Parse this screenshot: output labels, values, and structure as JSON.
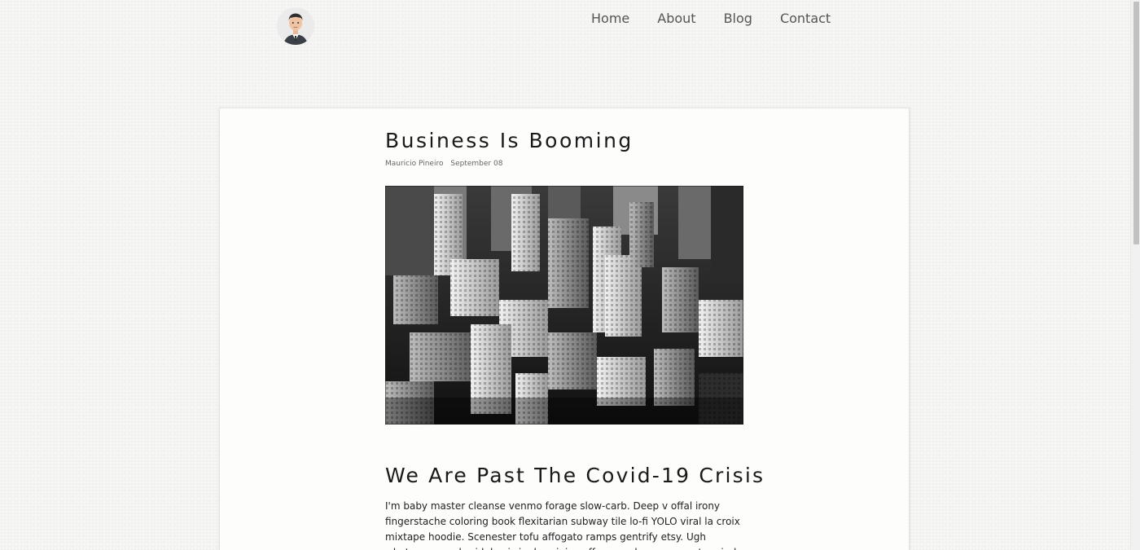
{
  "header": {
    "avatar_icon": "person-avatar-icon",
    "nav": [
      {
        "label": "Home"
      },
      {
        "label": "About"
      },
      {
        "label": "Blog"
      },
      {
        "label": "Contact"
      }
    ]
  },
  "post": {
    "title": "Business Is Booming",
    "author": "Mauricio Pineiro",
    "date": "September 08",
    "image_icon": "city-skyline-image",
    "section_title": "We Are Past The Covid-19 Crisis",
    "body": "I'm baby master cleanse venmo forage slow-carb. Deep v offal irony fingerstache coloring book flexitarian subway tile lo-fi YOLO viral la croix mixtape hoodie. Scenester tofu affogato ramps gentrify etsy. Ugh whatever man braid, kogi single-origin coffee cray hexagon neutra viral marfa try-hard"
  }
}
